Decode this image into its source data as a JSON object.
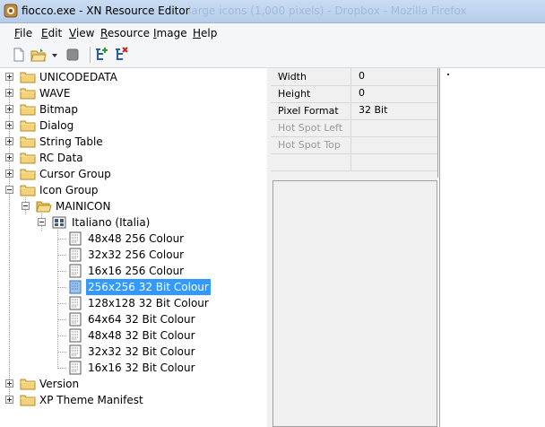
{
  "window": {
    "title": "fiocco.exe - XN Resource Editor",
    "ghost_title": "large icons (1,000 pixels) - Dropbox - Mozilla Firefox"
  },
  "menu": [
    "File",
    "Edit",
    "View",
    "Resource",
    "Image",
    "Help"
  ],
  "menu_mnemonics": [
    "F",
    "E",
    "V",
    "R",
    "I",
    "H"
  ],
  "toolbar": {
    "buttons": [
      "new-document-icon",
      "open-folder-icon",
      "dropdown-arrow-icon",
      "stop-icon",
      "add-resource-icon",
      "delete-resource-icon"
    ]
  },
  "tree": {
    "items": [
      {
        "label": "UNICODEDATA",
        "type": "folder",
        "expanded": false,
        "level": 0
      },
      {
        "label": "WAVE",
        "type": "folder",
        "expanded": false,
        "level": 0
      },
      {
        "label": "Bitmap",
        "type": "folder",
        "expanded": false,
        "level": 0
      },
      {
        "label": "Dialog",
        "type": "folder",
        "expanded": false,
        "level": 0
      },
      {
        "label": "String Table",
        "type": "folder",
        "expanded": false,
        "level": 0
      },
      {
        "label": "RC Data",
        "type": "folder",
        "expanded": false,
        "level": 0
      },
      {
        "label": "Cursor Group",
        "type": "folder",
        "expanded": false,
        "level": 0
      },
      {
        "label": "Icon Group",
        "type": "folder",
        "expanded": true,
        "level": 0
      },
      {
        "label": "MAINICON",
        "type": "folder-open",
        "expanded": true,
        "level": 1
      },
      {
        "label": "Italiano (Italia)",
        "type": "language",
        "expanded": true,
        "level": 2
      },
      {
        "label": "48x48 256 Colour",
        "type": "image",
        "level": 3
      },
      {
        "label": "32x32 256 Colour",
        "type": "image",
        "level": 3
      },
      {
        "label": "16x16 256 Colour",
        "type": "image",
        "level": 3
      },
      {
        "label": "256x256 32 Bit Colour",
        "type": "image",
        "level": 3,
        "selected": true
      },
      {
        "label": "128x128 32 Bit Colour",
        "type": "image",
        "level": 3
      },
      {
        "label": "64x64 32 Bit Colour",
        "type": "image",
        "level": 3
      },
      {
        "label": "48x48 32 Bit Colour",
        "type": "image",
        "level": 3
      },
      {
        "label": "32x32 32 Bit Colour",
        "type": "image",
        "level": 3
      },
      {
        "label": "16x16 32 Bit Colour",
        "type": "image",
        "level": 3
      },
      {
        "label": "Version",
        "type": "folder",
        "expanded": false,
        "level": 0
      },
      {
        "label": "XP Theme Manifest",
        "type": "folder",
        "expanded": false,
        "level": 0
      }
    ]
  },
  "properties": [
    {
      "name": "Width",
      "value": "0",
      "enabled": true
    },
    {
      "name": "Height",
      "value": "0",
      "enabled": true
    },
    {
      "name": "Pixel Format",
      "value": "32 Bit",
      "enabled": true
    },
    {
      "name": "Hot Spot Left",
      "value": "",
      "enabled": false
    },
    {
      "name": "Hot Spot Top",
      "value": "",
      "enabled": false
    },
    {
      "name": "",
      "value": "",
      "enabled": true
    }
  ],
  "colors": {
    "selection": "#3399ff",
    "folder": "#f3d27a",
    "titlebar": "#c9dcf3"
  }
}
